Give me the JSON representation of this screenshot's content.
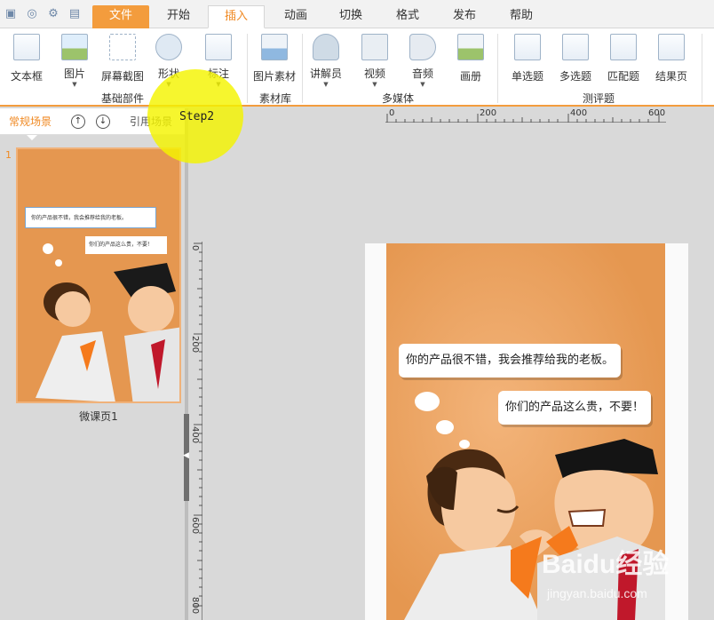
{
  "menu": {
    "tabs": [
      "文件",
      "开始",
      "插入",
      "动画",
      "切换",
      "格式",
      "发布",
      "帮助"
    ],
    "active": "插入"
  },
  "ribbon": {
    "groups": [
      {
        "label": "基础部件",
        "buttons": [
          "文本框",
          "图片",
          "屏幕截图",
          "形状",
          "标注"
        ]
      },
      {
        "label": "素材库",
        "buttons": [
          "图片素材"
        ]
      },
      {
        "label": "多媒体",
        "buttons": [
          "讲解员",
          "视频",
          "音频",
          "画册"
        ]
      },
      {
        "label": "测评题",
        "buttons": [
          "单选题",
          "多选题",
          "匹配题",
          "结果页"
        ]
      }
    ]
  },
  "left_panel": {
    "tabs": [
      "常规场景",
      "引用场景"
    ],
    "slide_number": "1",
    "slide_caption": "微课页1"
  },
  "rulers": {
    "horizontal": [
      "0",
      "200",
      "400",
      "600"
    ],
    "vertical": [
      "0",
      "200",
      "400",
      "600",
      "800"
    ]
  },
  "slide": {
    "bubble1": "你的产品很不错，我会推荐给我的老板。",
    "bubble2": "你们的产品这么贵，不要！",
    "thumb_bubble1": "你的产品很不错，我会推荐给我的老板。",
    "thumb_bubble2": "你们的产品这么贵，不要！"
  },
  "step_label": "Step2",
  "watermark": {
    "logo": "Baidu经验",
    "url": "jingyan.baidu.com"
  },
  "colors": {
    "accent": "#f39c3d",
    "slide_bg": "#e59750"
  }
}
